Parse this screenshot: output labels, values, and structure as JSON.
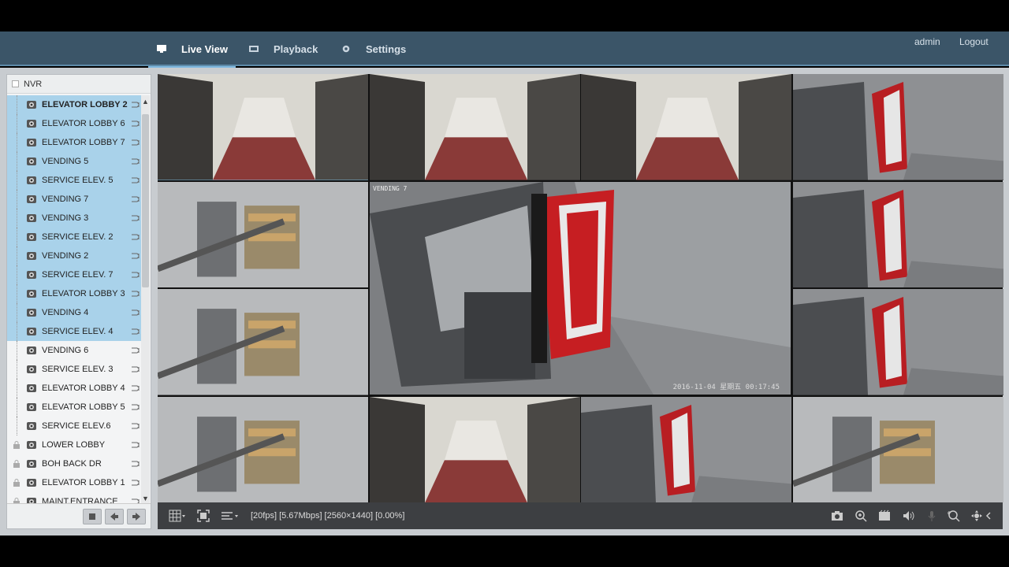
{
  "nav": {
    "tabs": [
      {
        "label": "Live View",
        "icon": "monitor-icon"
      },
      {
        "label": "Playback",
        "icon": "film-icon"
      },
      {
        "label": "Settings",
        "icon": "gear-icon"
      }
    ],
    "user": "admin",
    "logout": "Logout"
  },
  "tree": {
    "root": "NVR",
    "cameras": [
      {
        "label": "ELEVATOR LOBBY 2",
        "selected": true,
        "bold": true,
        "locked": false
      },
      {
        "label": "ELEVATOR LOBBY 6",
        "selected": true,
        "bold": false,
        "locked": false
      },
      {
        "label": "ELEVATOR LOBBY 7",
        "selected": true,
        "bold": false,
        "locked": false
      },
      {
        "label": "VENDING 5",
        "selected": true,
        "bold": false,
        "locked": false
      },
      {
        "label": "SERVICE ELEV. 5",
        "selected": true,
        "bold": false,
        "locked": false
      },
      {
        "label": "VENDING 7",
        "selected": true,
        "bold": false,
        "locked": false
      },
      {
        "label": "VENDING 3",
        "selected": true,
        "bold": false,
        "locked": false
      },
      {
        "label": "SERVICE ELEV. 2",
        "selected": true,
        "bold": false,
        "locked": false
      },
      {
        "label": "VENDING 2",
        "selected": true,
        "bold": false,
        "locked": false
      },
      {
        "label": "SERVICE ELEV. 7",
        "selected": true,
        "bold": false,
        "locked": false
      },
      {
        "label": "ELEVATOR LOBBY 3",
        "selected": true,
        "bold": false,
        "locked": false
      },
      {
        "label": "VENDING 4",
        "selected": true,
        "bold": false,
        "locked": false
      },
      {
        "label": "SERVICE ELEV. 4",
        "selected": true,
        "bold": false,
        "locked": false
      },
      {
        "label": "VENDING 6",
        "selected": false,
        "bold": false,
        "locked": false
      },
      {
        "label": "SERVICE ELEV. 3",
        "selected": false,
        "bold": false,
        "locked": false
      },
      {
        "label": "ELEVATOR LOBBY 4",
        "selected": false,
        "bold": false,
        "locked": false
      },
      {
        "label": "ELEVATOR LOBBY 5",
        "selected": false,
        "bold": false,
        "locked": false
      },
      {
        "label": "SERVICE ELEV.6",
        "selected": false,
        "bold": false,
        "locked": false
      },
      {
        "label": "LOWER LOBBY",
        "selected": false,
        "bold": false,
        "locked": true
      },
      {
        "label": "BOH BACK DR",
        "selected": false,
        "bold": false,
        "locked": true
      },
      {
        "label": "ELEVATOR LOBBY 1",
        "selected": false,
        "bold": false,
        "locked": true
      },
      {
        "label": "MAINT.ENTRANCE",
        "selected": false,
        "bold": false,
        "locked": true
      }
    ]
  },
  "wall": {
    "big_tile": {
      "osd": "VENDING 7",
      "timestamp": "2016-11-04 星期五 00:17:45"
    }
  },
  "toolbar": {
    "stats": "[20fps] [5.67Mbps] [2560×1440] [0.00%]"
  },
  "colors": {
    "header_bg": "#3b5568",
    "selected_row": "#a9d2ea",
    "toolbar_bg": "#3d3f42"
  }
}
